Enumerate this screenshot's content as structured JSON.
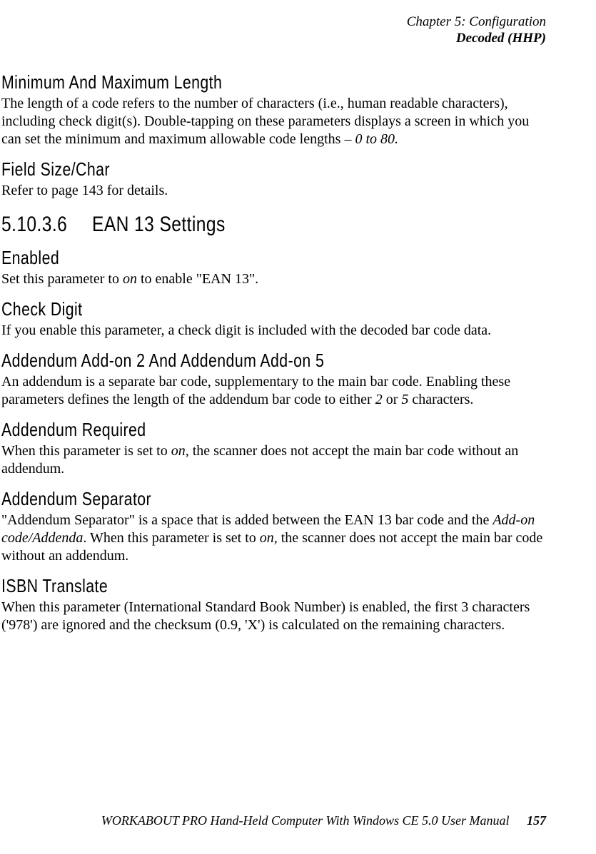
{
  "header": {
    "chapter": "Chapter 5: Configuration",
    "section": "Decoded (HHP)"
  },
  "s1": {
    "h": "Minimum And Maximum Length",
    "p1a": "The length of a code refers to the number of characters (i.e., human readable characters), including check digit(s). Double-tapping on these parameters displays a screen in which you can set the minimum and maximum allowable code lengths – ",
    "p1b": "0 to 80.",
    "p1c": ""
  },
  "s2": {
    "h": "Field Size/Char",
    "p": "Refer to page 143 for details."
  },
  "sec": {
    "num": "5.10.3.6",
    "title": "EAN 13 Settings"
  },
  "s3": {
    "h": "Enabled",
    "p1a": "Set this parameter to ",
    "p1b": "on",
    "p1c": " to enable \"EAN 13\"."
  },
  "s4": {
    "h": "Check Digit",
    "p": "If you enable this parameter, a check digit is included with the decoded bar code data."
  },
  "s5": {
    "h": "Addendum Add-on 2 And Addendum Add-on 5",
    "p1a": "An addendum is a separate bar code, supplementary to the main bar code. Enabling these parameters defines the length of the addendum bar code to either ",
    "p1b": "2",
    "p1c": " or ",
    "p1d": "5",
    "p1e": " characters."
  },
  "s6": {
    "h": "Addendum Required",
    "p1a": "When this parameter is set to ",
    "p1b": "on,",
    "p1c": " the scanner does not accept the main bar code without an addendum."
  },
  "s7": {
    "h": "Addendum Separator",
    "p1a": "\"Addendum Separator\" is a space that is added between the EAN 13 bar code and the ",
    "p1b": "Add-on code/Addenda",
    "p1c": ". When this parameter is set to ",
    "p1d": "on,",
    "p1e": " the scanner does not accept the main bar code without an addendum."
  },
  "s8": {
    "h": "ISBN Translate",
    "p": "When this parameter (International Standard Book Number) is enabled, the first 3 characters ('978') are ignored and the checksum (0.9, 'X') is calculated on the remaining characters."
  },
  "footer": {
    "title": "WORKABOUT PRO Hand-Held Computer With Windows CE 5.0 User Manual",
    "page": "157"
  }
}
